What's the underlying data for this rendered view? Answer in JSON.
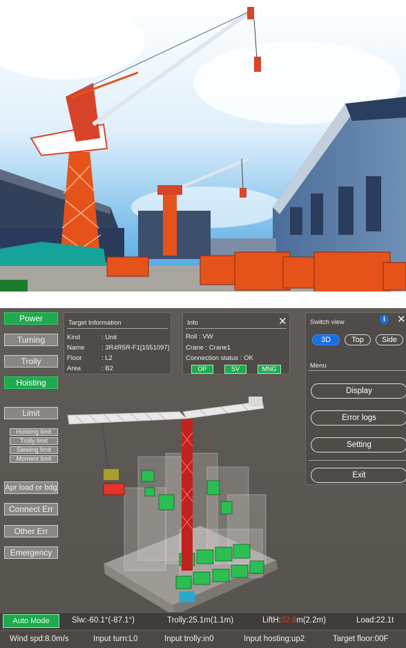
{
  "left_buttons": {
    "power": "Power",
    "turning": "Turning",
    "trolly": "Trolly",
    "hoisting": "Hoisting",
    "limit": "Limit",
    "hoisting_limit": "Hoisting limit",
    "trolly_limit": "Trolly limit",
    "slewing_limit": "Slewing limit",
    "moment_limit": "Moment limit",
    "apr_load": "Apr load or bdg",
    "connect_err": "Connect Err",
    "other_err": "Other Err",
    "emergency": "Emergency"
  },
  "target_info": {
    "title": "Target Information",
    "rows": [
      {
        "key": "Kind",
        "value": ": Unit"
      },
      {
        "key": "Name",
        "value": ": 3R4R5R-F1[1551097]"
      },
      {
        "key": "Floor",
        "value": ": L2"
      },
      {
        "key": "Area",
        "value": ": B2"
      }
    ]
  },
  "info": {
    "title": "Info",
    "roll": "Roll : VW",
    "crane": "Crane : Crane1",
    "connection": "Connection status : OK",
    "buttons": [
      "OP",
      "SV",
      "MNG"
    ],
    "close_glyph": "✕"
  },
  "switch_view": {
    "title": "Switch view",
    "info_glyph": "i",
    "close_glyph": "✕",
    "options": [
      "3D",
      "Top",
      "Side"
    ],
    "selected": "3D"
  },
  "menu": {
    "title": "Menu",
    "items": [
      "Display",
      "Error logs",
      "Setting"
    ],
    "exit": "Exit"
  },
  "status1": {
    "mode": "Auto Mode",
    "slw": "Slw:-60.1°(-87.1°)",
    "trolly": "Trolly:25.1m(1.1m)",
    "lifth_prefix": "LiftH:",
    "lifth_value": "32.6",
    "lifth_suffix": "m(2.2m)",
    "load": "Load:22.1t"
  },
  "status2": {
    "wind": "Wind spd:8.0m/s",
    "input_turn": "Input turn:L0",
    "input_trolly": "Input trolly:in0",
    "input_hosting": "Input hosting:up2",
    "target_floor": "Target floor:00F"
  },
  "colors": {
    "active_green": "#1faa4e",
    "selected_blue": "#1a6fe0",
    "crane_orange": "#e5531a",
    "lifth_red": "#e8332a"
  },
  "icons": [
    "close-icon",
    "info-icon"
  ]
}
